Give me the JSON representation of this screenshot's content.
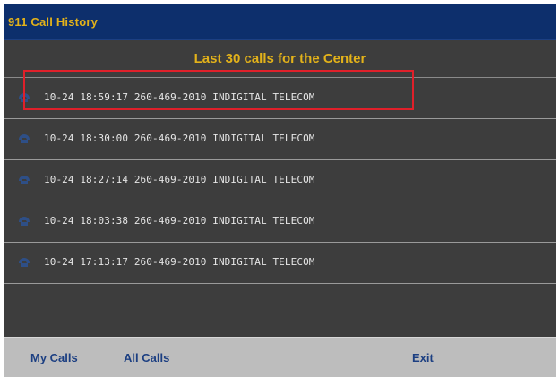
{
  "header": {
    "title": "911 Call History"
  },
  "subheader": {
    "text": "Last 30 calls for the Center"
  },
  "calls": [
    {
      "text": "10-24 18:59:17 260-469-2010 INDIGITAL TELECOM",
      "icon": "phone-icon"
    },
    {
      "text": "10-24 18:30:00 260-469-2010 INDIGITAL TELECOM",
      "icon": "phone-icon"
    },
    {
      "text": "10-24 18:27:14 260-469-2010 INDIGITAL TELECOM",
      "icon": "phone-icon"
    },
    {
      "text": "10-24 18:03:38 260-469-2010 INDIGITAL TELECOM",
      "icon": "phone-icon"
    },
    {
      "text": "10-24 17:13:17 260-469-2010 INDIGITAL TELECOM",
      "icon": "phone-icon"
    }
  ],
  "footer": {
    "my_calls": "My Calls",
    "all_calls": "All Calls",
    "exit": "Exit"
  },
  "colors": {
    "titlebar": "#0d2f6c",
    "accent_text": "#e3b21a",
    "body": "#3d3d3d",
    "footer": "#bdbdbd",
    "footer_text": "#1c3f82",
    "highlight": "#e0202a"
  }
}
